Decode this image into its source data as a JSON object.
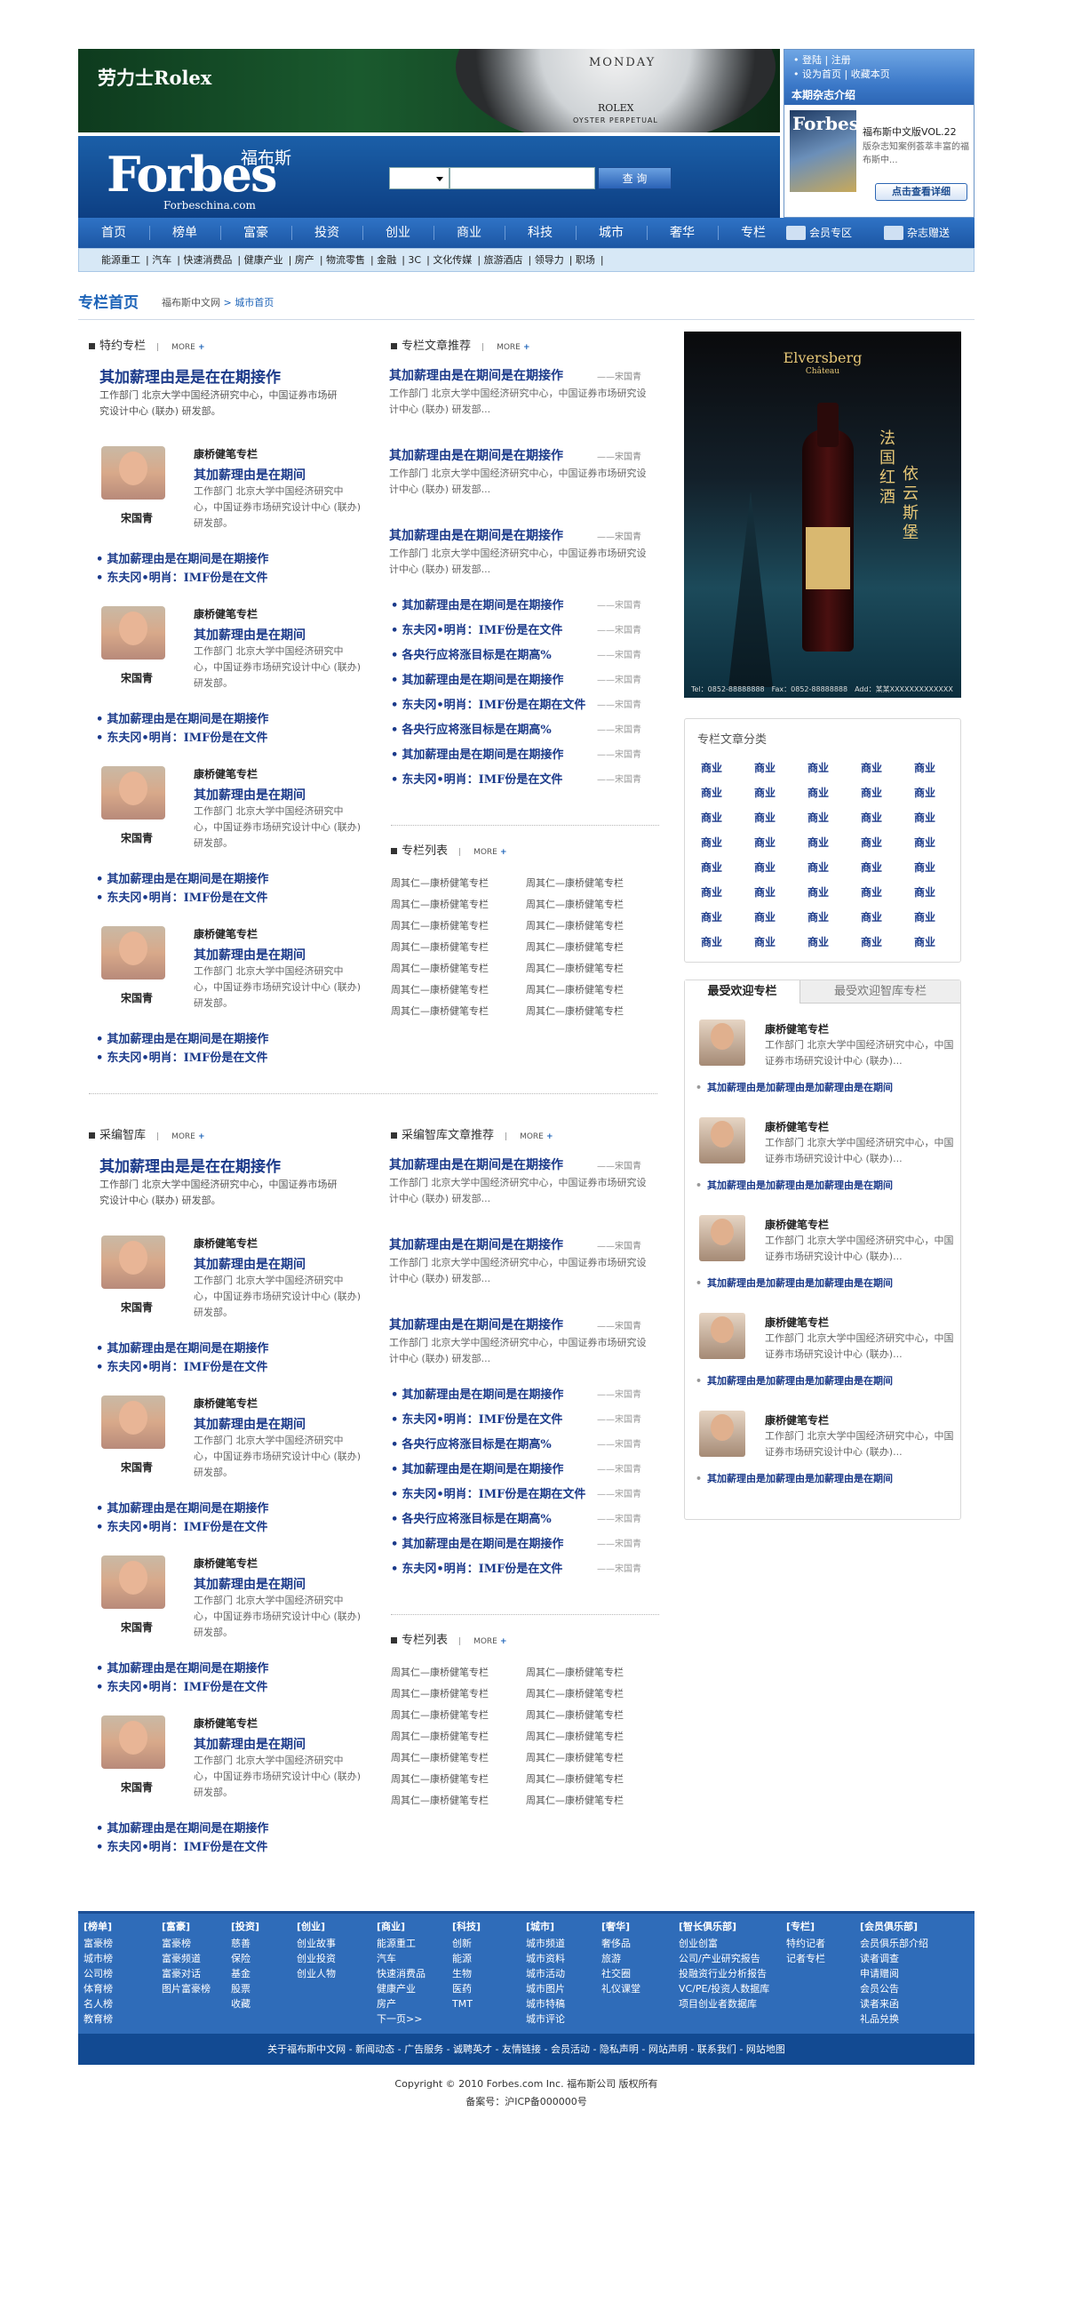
{
  "header": {
    "ad_brand": "劳力士Rolex",
    "watch_day": "MONDAY",
    "watch_brand": "ROLEX",
    "watch_model": "OYSTER PERPETUAL",
    "logo": "Forbes",
    "logo_cn": "福布斯",
    "logo_url": "Forbeschina.com",
    "search_button": "查 询",
    "links": [
      "登陆",
      "注册",
      "设为首页",
      "收藏本页"
    ],
    "magazine_head": "本期杂志介绍",
    "magazine_cover": "Forbes",
    "magazine_title": "福布斯中文版VOL.22",
    "magazine_desc": "版杂志知案例荟萃丰富的福布斯中...",
    "magazine_button": "点击查看详细"
  },
  "nav": {
    "items": [
      "首页",
      "榜单",
      "富豪",
      "投资",
      "创业",
      "商业",
      "科技",
      "城市",
      "奢华",
      "专栏"
    ],
    "tools": [
      "会员专区",
      "杂志赠送"
    ]
  },
  "subnav": [
    "能源重工",
    "汽车",
    "快速消费品",
    "健康产业",
    "房产",
    "物流零售",
    "金融",
    "3C",
    "文化传媒",
    "旅游酒店",
    "领导力",
    "职场"
  ],
  "crumb": {
    "title": "专栏首页",
    "path1": "福布斯中文网",
    "sep": ">",
    "path2": "城市首页"
  },
  "more": "MORE",
  "s1": {
    "head": "特约专栏",
    "big": "其加薪理由是是在在期接作",
    "desc": "工作部门 北京大学中国经济研究中心，中国证券市场研究设计中心 (联办) 研发部。"
  },
  "card": {
    "title": "康桥健笔专栏",
    "hl": "其加薪理由是在期间",
    "desc": "工作部门 北京大学中国经济研究中心，中国证券市场研究设计中心 (联办) 研发部。",
    "name": "宋国青",
    "b1": "其加薪理由是在期间是在期接作",
    "b2": "东夫冈•明肖：IMF份是在文件"
  },
  "s2": {
    "head": "专栏文章推荐"
  },
  "art": {
    "h": "其加薪理由是在期间是在期接作",
    "author": "——宋国青",
    "desc": "工作部门 北京大学中国经济研究中心，中国证券市场研究设计中心 (联办) 研发部..."
  },
  "bl": [
    "其加薪理由是在期间是在期接作",
    "东夫冈•明肖：IMF份是在文件",
    "各央行应将涨目标是在期高%",
    "其加薪理由是在期间是在期接作",
    "东夫冈•明肖：IMF份是在期在文件",
    "各央行应将涨目标是在期高%",
    "其加薪理由是在期间是在期接作",
    "东夫冈•明肖：IMF份是在文件"
  ],
  "bl_author": "——宋国青",
  "s3": {
    "head": "专栏列表"
  },
  "ls": "周其仁—康桥健笔专栏",
  "s4": {
    "head": "采编智库",
    "big": "其加薪理由是是在在期接作",
    "desc": "工作部门 北京大学中国经济研究中心，中国证券市场研究设计中心 (联办) 研发部。"
  },
  "s5": {
    "head": "采编智库文章推荐"
  },
  "ad": {
    "brand": "Elversberg",
    "sub": "Château",
    "cn1": "法国红酒",
    "cn2": "依云斯堡",
    "footer": "Tel：0852-88888888　Fax：0852-88888888　Add：某某XXXXXXXXXXXXX"
  },
  "cat": {
    "head": "专栏文章分类",
    "item": "商业"
  },
  "pop": {
    "tab1": "最受欢迎专栏",
    "tab2": "最受欢迎智库专栏",
    "name": "康桥健笔专栏",
    "desc": "工作部门 北京大学中国经济研究中心，中国证券市场研究设计中心 (联办)...",
    "link": "其加薪理由是加薪理由是加薪理由是在期间"
  },
  "footer": {
    "cols": [
      {
        "h": "[榜单]",
        "i": [
          "富豪榜",
          "城市榜",
          "公司榜",
          "体育榜",
          "名人榜",
          "教育榜"
        ]
      },
      {
        "h": "[富豪]",
        "i": [
          "富豪榜",
          "富豪频道",
          "富豪对话",
          "图片富豪榜"
        ]
      },
      {
        "h": "[投资]",
        "i": [
          "慈善",
          "保险",
          "基金",
          "股票",
          "收藏"
        ]
      },
      {
        "h": "[创业]",
        "i": [
          "创业故事",
          "创业投资",
          "创业人物"
        ]
      },
      {
        "h": "[商业]",
        "i": [
          "能源重工",
          "汽车",
          "快速消费品",
          "健康产业",
          "房产",
          "下一页>>"
        ]
      },
      {
        "h": "[科技]",
        "i": [
          "创新",
          "能源",
          "生物",
          "医药",
          "TMT"
        ]
      },
      {
        "h": "[城市]",
        "i": [
          "城市频道",
          "城市资料",
          "城市活动",
          "城市图片",
          "城市特稿",
          "城市评论"
        ]
      },
      {
        "h": "[奢华]",
        "i": [
          "奢侈品",
          "旅游",
          "社交圈",
          "礼仪课堂"
        ]
      },
      {
        "h": "[智长俱乐部]",
        "i": [
          "创业创富",
          "公司/产业研究报告",
          "投融资行业分析报告",
          "VC/PE/投资人数据库",
          "项目创业者数据库"
        ]
      },
      {
        "h": "[专栏]",
        "i": [
          "特约记者",
          "记者专栏"
        ]
      },
      {
        "h": "[会员俱乐部]",
        "i": [
          "会员俱乐部介绍",
          "读者调查",
          "申请赠阅",
          "会员公告",
          "读者来函",
          "礼品兑换"
        ]
      }
    ],
    "bar": "关于福布斯中文网 - 新闻动态 - 广告服务 - 诚聘英才 - 友情链接 - 会员活动 - 隐私声明 - 网站声明 - 联系我们 - 网站地图",
    "copyright": "Copyright © 2010 Forbes.com Inc. 福布斯公司 版权所有",
    "icp": "备案号：沪ICP备000000号"
  },
  "colors": {
    "primary": "#1c63b8",
    "navy": "#1b3a8a",
    "footer": "#2f6cb9"
  }
}
